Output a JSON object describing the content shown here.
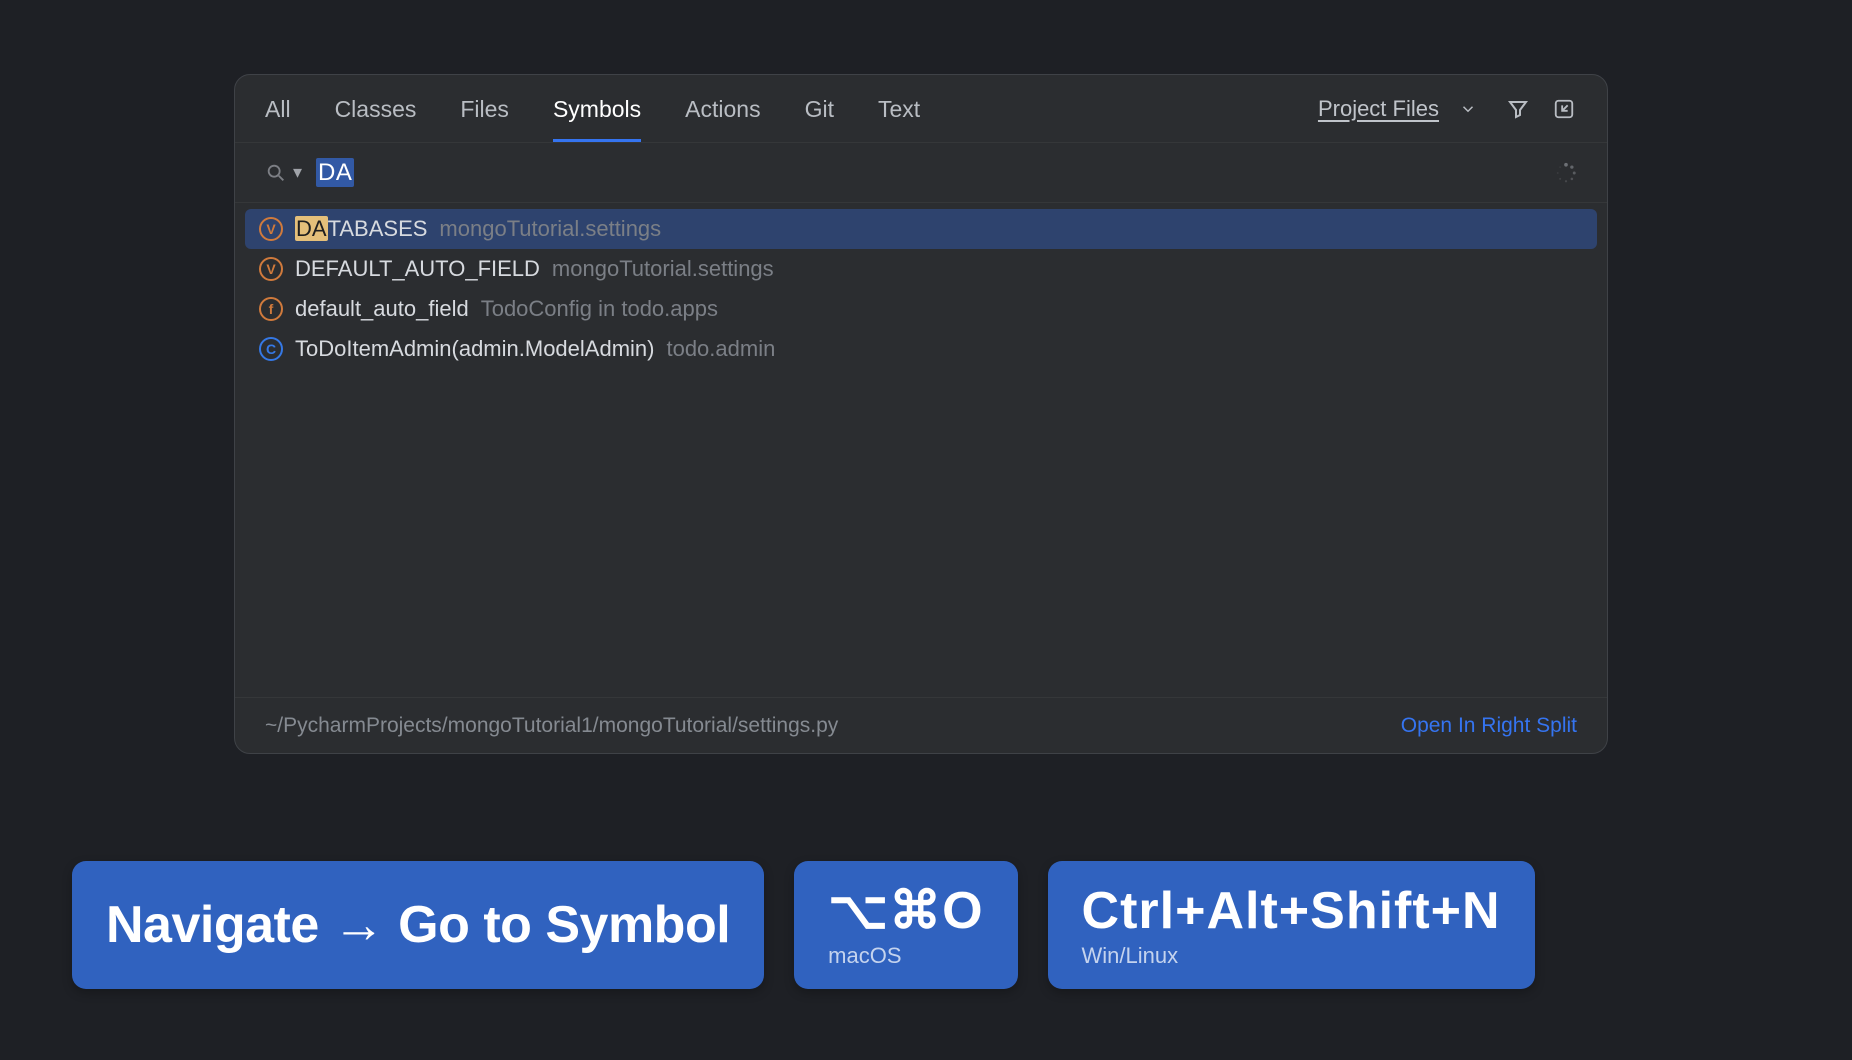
{
  "tabs": {
    "items": [
      "All",
      "Classes",
      "Files",
      "Symbols",
      "Actions",
      "Git",
      "Text"
    ],
    "activeIndex": 3,
    "scopeLabel": "Project Files"
  },
  "search": {
    "query": "DA"
  },
  "results": [
    {
      "iconType": "v",
      "iconLetter": "V",
      "name": "DATABASES",
      "matchLen": 2,
      "location": "mongoTutorial.settings",
      "selected": true
    },
    {
      "iconType": "v",
      "iconLetter": "V",
      "name": "DEFAULT_AUTO_FIELD",
      "matchLen": 0,
      "location": "mongoTutorial.settings",
      "selected": false
    },
    {
      "iconType": "f",
      "iconLetter": "f",
      "name": "default_auto_field",
      "matchLen": 0,
      "location": "TodoConfig in todo.apps",
      "selected": false
    },
    {
      "iconType": "c",
      "iconLetter": "C",
      "name": "ToDoItemAdmin(admin.ModelAdmin)",
      "matchLen": 0,
      "location": "todo.admin",
      "selected": false
    }
  ],
  "footer": {
    "path": "~/PycharmProjects/mongoTutorial1/mongoTutorial/settings.py",
    "link": "Open In Right Split"
  },
  "pills": {
    "menuPath": "Navigate → Go to Symbol",
    "macShortcut": "⌥⌘O",
    "macLabel": "macOS",
    "winShortcut": "Ctrl+Alt+Shift+N",
    "winLabel": "Win/Linux"
  }
}
